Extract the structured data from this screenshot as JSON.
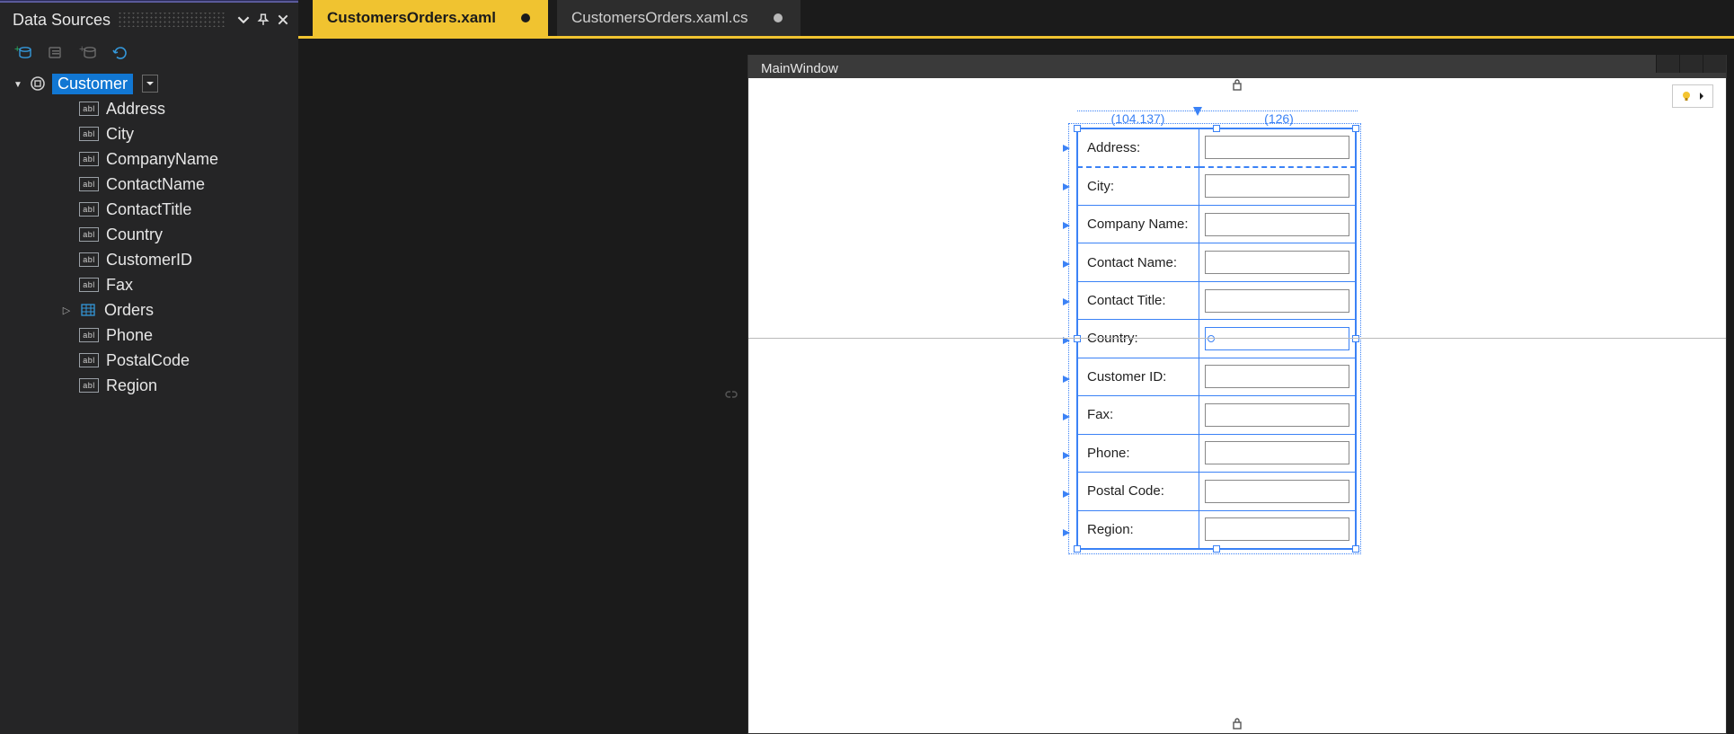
{
  "panel": {
    "title": "Data Sources",
    "root_node": "Customer",
    "fields": [
      {
        "type": "abl",
        "label": "Address"
      },
      {
        "type": "abl",
        "label": "City"
      },
      {
        "type": "abl",
        "label": "CompanyName"
      },
      {
        "type": "abl",
        "label": "ContactName"
      },
      {
        "type": "abl",
        "label": "ContactTitle"
      },
      {
        "type": "abl",
        "label": "Country"
      },
      {
        "type": "abl",
        "label": "CustomerID"
      },
      {
        "type": "abl",
        "label": "Fax"
      },
      {
        "type": "grid",
        "label": "Orders",
        "expandable": true
      },
      {
        "type": "abl",
        "label": "Phone"
      },
      {
        "type": "abl",
        "label": "PostalCode"
      },
      {
        "type": "abl",
        "label": "Region"
      }
    ]
  },
  "tabs": {
    "active": {
      "label": "CustomersOrders.xaml",
      "dirty": true
    },
    "inactive": {
      "label": "CustomersOrders.xaml.cs",
      "dirty": true
    }
  },
  "designer": {
    "window_title": "MainWindow",
    "col_measures": {
      "left": "(104.137)",
      "right": "(126)"
    },
    "rows": [
      {
        "label": "Address:"
      },
      {
        "label": "City:"
      },
      {
        "label": "Company Name:"
      },
      {
        "label": "Contact Name:"
      },
      {
        "label": "Contact Title:"
      },
      {
        "label": "Country:"
      },
      {
        "label": "Customer ID:"
      },
      {
        "label": "Fax:"
      },
      {
        "label": "Phone:"
      },
      {
        "label": "Postal Code:"
      },
      {
        "label": "Region:"
      }
    ]
  }
}
